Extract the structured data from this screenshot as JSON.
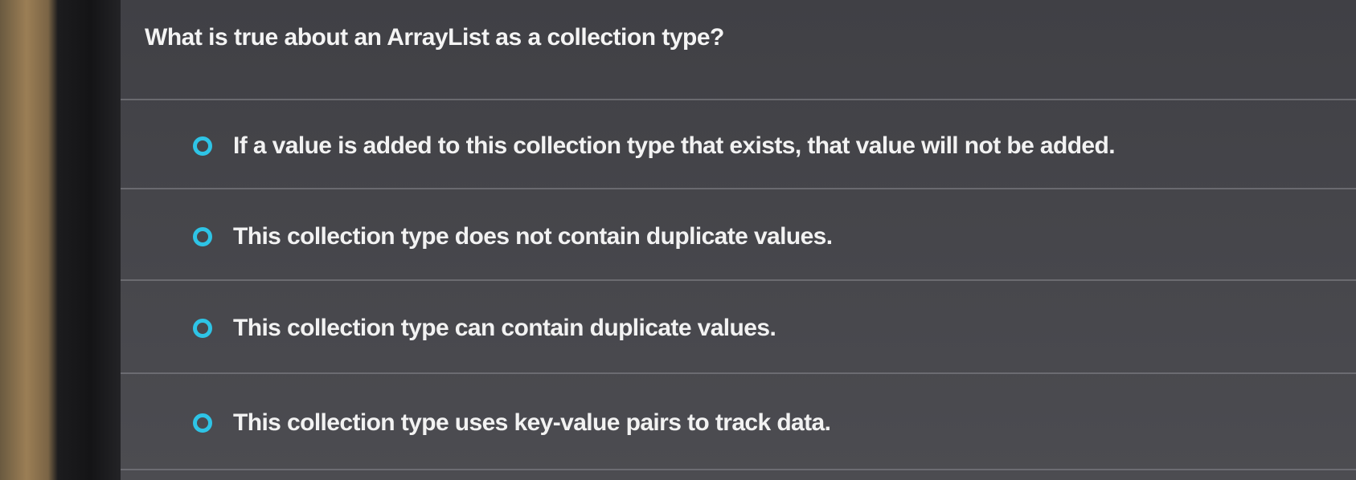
{
  "question": {
    "text": "What is true about an ArrayList as a collection type?"
  },
  "options": [
    {
      "label": "If a value is added to this collection type that exists, that value will not be added.",
      "selected": false
    },
    {
      "label": "This collection type does not contain duplicate values.",
      "selected": false
    },
    {
      "label": "This collection type can contain duplicate values.",
      "selected": false
    },
    {
      "label": "This collection type uses key-value pairs to track data.",
      "selected": false
    }
  ],
  "colors": {
    "radio_accent": "#2ec4e6",
    "text": "#f2f2f2",
    "background": "#46464b"
  }
}
